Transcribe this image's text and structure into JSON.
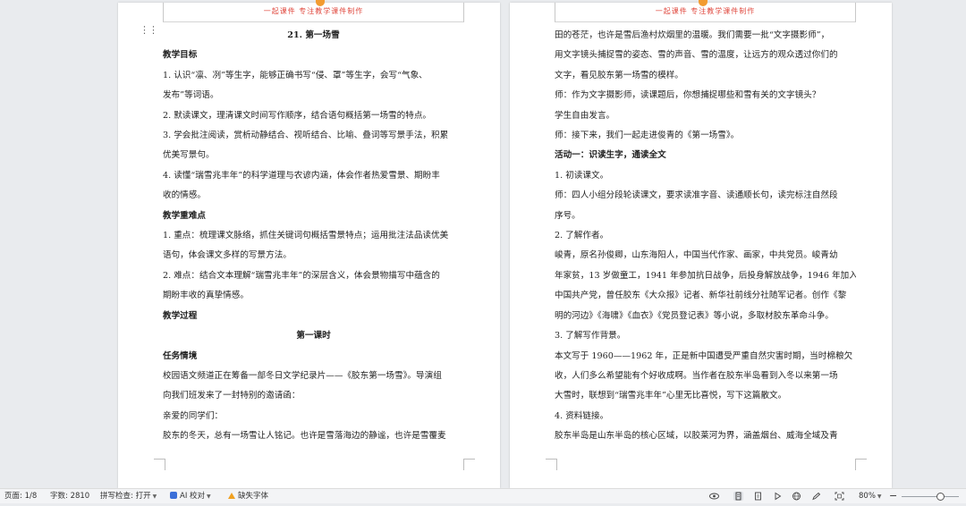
{
  "header_text": "一起课件  专注教学课件制作",
  "left_page": {
    "lines": [
      {
        "text": "21. 第一场雪",
        "style": "bold center"
      },
      {
        "text": "教学目标",
        "style": "bold"
      },
      {
        "text": "1. 认识“凛、冽”等生字，能够正确书写“侵、罩”等生字，会写“气象、",
        "style": ""
      },
      {
        "text": "发布”等词语。",
        "style": ""
      },
      {
        "text": "2. 默读课文，理清课文时间写作顺序，结合语句概括第一场雪的特点。",
        "style": ""
      },
      {
        "text": "3. 学会批注阅读，赏析动静结合、视听结合、比喻、叠词等写景手法，积累",
        "style": ""
      },
      {
        "text": "优美写景句。",
        "style": ""
      },
      {
        "text": "4. 读懂“瑞雪兆丰年”的科学道理与农谚内涵，体会作者热爱雪景、期盼丰",
        "style": ""
      },
      {
        "text": "收的情感。",
        "style": ""
      },
      {
        "text": "教学重难点",
        "style": "bold"
      },
      {
        "text": "1. 重点：梳理课文脉络，抓住关键词句概括雪景特点；运用批注法品读优美",
        "style": ""
      },
      {
        "text": "语句，体会课文多样的写景方法。",
        "style": ""
      },
      {
        "text": "2. 难点：结合文本理解“瑞雪兆丰年”的深层含义，体会景物描写中蕴含的",
        "style": ""
      },
      {
        "text": "期盼丰收的真挚情感。",
        "style": ""
      },
      {
        "text": "教学过程",
        "style": "bold"
      },
      {
        "text": "第一课时",
        "style": "bold center"
      },
      {
        "text": "任务情境",
        "style": "bold"
      },
      {
        "text": "校园语文频道正在筹备一部冬日文学纪录片——《胶东第一场雪》。导演组",
        "style": ""
      },
      {
        "text": "向我们班发来了一封特别的邀请函：",
        "style": ""
      },
      {
        "text": "亲爱的同学们：",
        "style": ""
      },
      {
        "text": "胶东的冬天，总有一场雪让人铭记。也许是雪落海边的静谧，也许是雪覆麦",
        "style": ""
      }
    ]
  },
  "right_page": {
    "lines": [
      {
        "text": "田的苍茫，也许是雪后渔村炊烟里的温暖。我们需要一批“文字摄影师”，",
        "style": ""
      },
      {
        "text": "用文字镜头捕捉雪的姿态、雪的声音、雪的温度，让远方的观众透过你们的",
        "style": ""
      },
      {
        "text": "文字，看见胶东第一场雪的模样。",
        "style": ""
      },
      {
        "text": "师：作为文字摄影师，读课题后，你想捕捉哪些和雪有关的文字镜头？",
        "style": ""
      },
      {
        "text": "学生自由发言。",
        "style": ""
      },
      {
        "text": "师：接下来，我们一起走进俊青的《第一场雪》。",
        "style": ""
      },
      {
        "text": "活动一：识读生字，通读全文",
        "style": "bold"
      },
      {
        "text": "1. 初读课文。",
        "style": ""
      },
      {
        "text": "师：四人小组分段轮读课文，要求读准字音、读通顺长句，读完标注自然段",
        "style": ""
      },
      {
        "text": "序号。",
        "style": ""
      },
      {
        "text": "2. 了解作者。",
        "style": ""
      },
      {
        "text": "峻青，原名孙俊卿，山东海阳人，中国当代作家、画家，中共党员。峻青幼",
        "style": ""
      },
      {
        "text": "年家贫，13 岁做童工，1941 年参加抗日战争，后投身解放战争，1946 年加入",
        "style": ""
      },
      {
        "text": "中国共产党，曾任胶东《大众报》记者、新华社前线分社随军记者。创作《黎",
        "style": ""
      },
      {
        "text": "明的河边》《海啸》《血衣》《党员登记表》等小说，多取材胶东革命斗争。",
        "style": ""
      },
      {
        "text": "3. 了解写作背景。",
        "style": ""
      },
      {
        "text": "本文写于 1960——1962 年，正是新中国遭受严重自然灾害时期，当时棉粮欠",
        "style": ""
      },
      {
        "text": "收，人们多么希望能有个好收成啊。当作者在胶东半岛看到入冬以来第一场",
        "style": ""
      },
      {
        "text": "大雪时，联想到“瑞雪兆丰年”心里无比喜悦，写下这篇散文。",
        "style": ""
      },
      {
        "text": "4. 资料链接。",
        "style": ""
      },
      {
        "text": "胶东半岛是山东半岛的核心区域，以胶莱河为界，涵盖烟台、威海全域及青",
        "style": ""
      }
    ]
  },
  "statusbar": {
    "page": "页面: 1/8",
    "words": "字数: 2810",
    "spell": "拼写检查: 打开",
    "ai": "AI 校对",
    "missing_font": "缺失字体",
    "zoom": "80%"
  }
}
